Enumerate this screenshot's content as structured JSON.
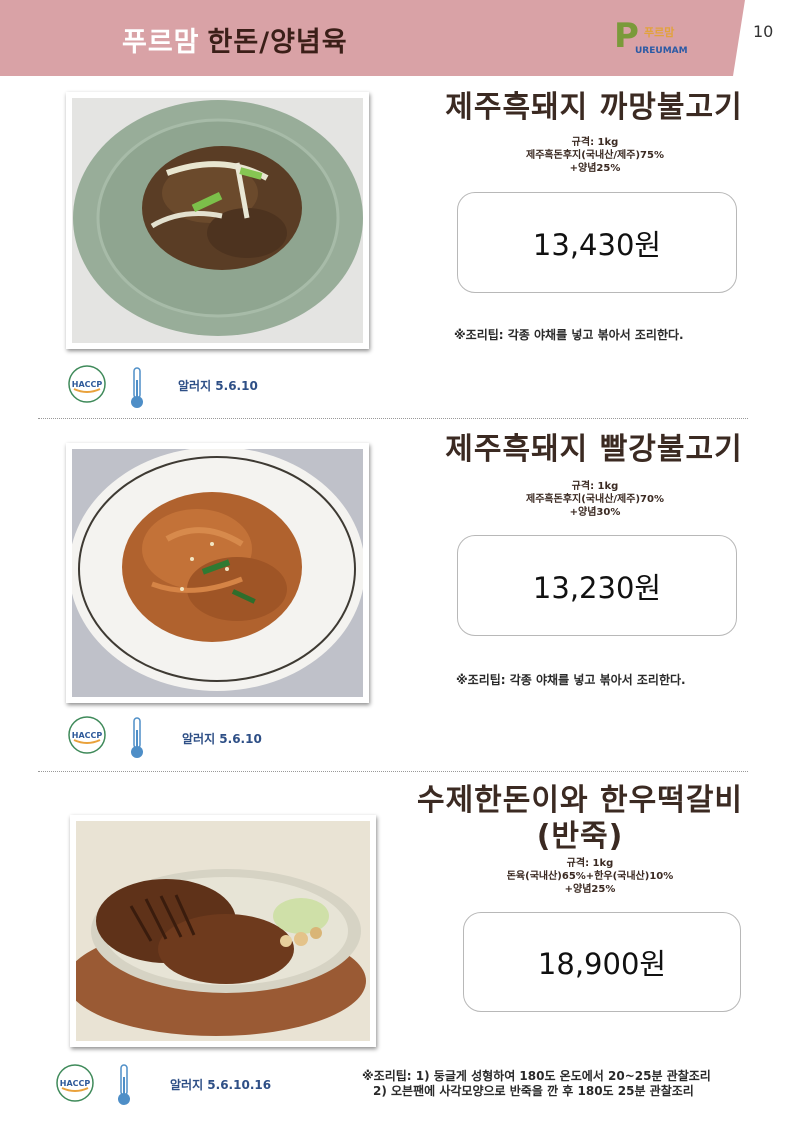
{
  "header": {
    "brand": "푸르맘",
    "category": "한돈/양념육",
    "logo_kr": "푸르맘",
    "logo_en": "UREUMAM",
    "page_number": "10"
  },
  "products": [
    {
      "name": "제주흑돼지 까망불고기",
      "spec_1": "규격: 1kg",
      "spec_2": "제주흑돈후지(국내산/제주)75%",
      "spec_3": "+양념25%",
      "price": "13,430원",
      "tip": "※조리팁: 각종 야채를 넣고 볶아서 조리한다.",
      "allergy": "알러지 5.6.10",
      "haccp_label": "HACCP"
    },
    {
      "name": "제주흑돼지 빨강불고기",
      "spec_1": "규격: 1kg",
      "spec_2": "제주흑돈후지(국내산/제주)70%",
      "spec_3": "+양념30%",
      "price": "13,230원",
      "tip": "※조리팁: 각종 야채를 넣고 볶아서 조리한다.",
      "allergy": "알러지 5.6.10",
      "haccp_label": "HACCP"
    },
    {
      "name_line1": "수제한돈이와 한우떡갈비",
      "name_line2": "(반죽)",
      "spec_1": "규격: 1kg",
      "spec_2": "돈육(국내산)65%+한우(국내산)10%",
      "spec_3": "+양념25%",
      "price": "18,900원",
      "tip_line1": "※조리팁: 1) 둥글게 성형하여 180도 온도에서 20~25분 관찰조리",
      "tip_line2": "2) 오븐팬에 사각모양으로 반죽을 깐 후 180도 25분 관찰조리",
      "allergy": "알러지 5.6.10.16",
      "haccp_label": "HACCP"
    }
  ],
  "colors": {
    "header_bg": "#d9a2a6",
    "title_dark": "#3b1f18",
    "allergy_blue": "#2e4f86",
    "haccp_green": "#3f8a5a",
    "thermo_blue": "#4e8ec7"
  }
}
